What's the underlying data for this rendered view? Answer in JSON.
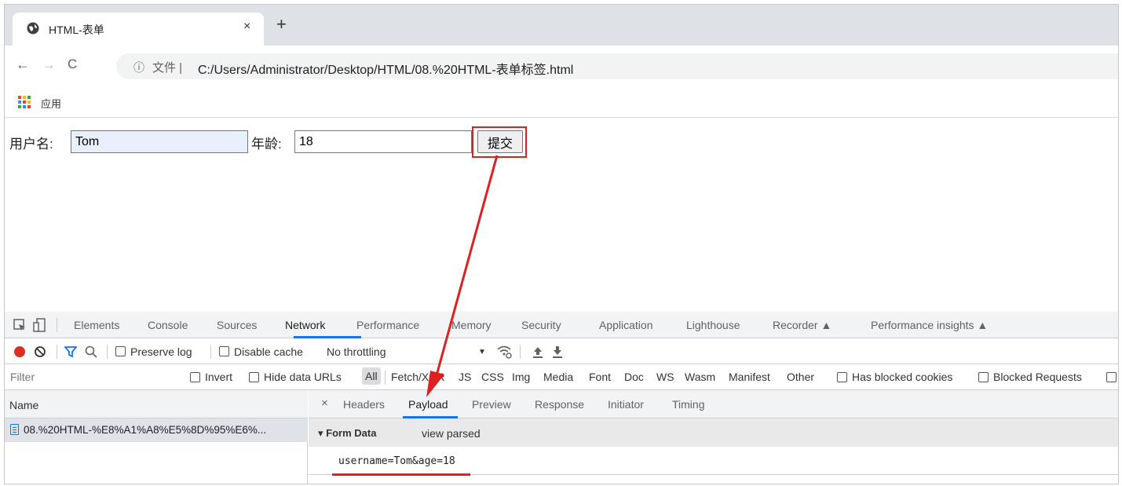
{
  "browser": {
    "tab_title": "HTML-表单",
    "tab_close": "×",
    "new_tab": "+",
    "back": "←",
    "forward": "→",
    "reload": "C",
    "info_icon": "ⓘ",
    "address_label": "文件 |",
    "url": "C:/Users/Administrator/Desktop/HTML/08.%20HTML-表单标签.html",
    "bookmark_apps": "应用"
  },
  "page": {
    "username_label": "用户名:",
    "username_value": "Tom",
    "age_label": "年龄:",
    "age_value": "18",
    "submit_label": "提交"
  },
  "devtools": {
    "tabs": [
      "Elements",
      "Console",
      "Sources",
      "Network",
      "Performance",
      "Memory",
      "Security",
      "Application",
      "Lighthouse",
      "Recorder ▲",
      "Performance insights ▲"
    ],
    "active_tab": "Network",
    "toolbar": {
      "preserve_log": "Preserve log",
      "disable_cache": "Disable cache",
      "throttling": "No throttling",
      "throttle_arrow": "▼"
    },
    "filter": {
      "placeholder": "Filter",
      "invert": "Invert",
      "hide_data_urls": "Hide data URLs",
      "types": [
        "All",
        "Fetch/XHR",
        "JS",
        "CSS",
        "Img",
        "Media",
        "Font",
        "Doc",
        "WS",
        "Wasm",
        "Manifest",
        "Other"
      ],
      "has_blocked_cookies": "Has blocked cookies",
      "blocked_requests": "Blocked Requests"
    },
    "requests": {
      "name_header": "Name",
      "rows": [
        "08.%20HTML-%E8%A1%A8%E5%8D%95%E6%..."
      ]
    },
    "detail": {
      "close": "×",
      "tabs": [
        "Headers",
        "Payload",
        "Preview",
        "Response",
        "Initiator",
        "Timing"
      ],
      "active_tab": "Payload",
      "form_data_title": "▾ Form Data",
      "view_parsed": "view parsed",
      "raw_payload": "username=Tom&age=18"
    }
  },
  "colors": {
    "accent": "#1a73e8",
    "annotation_red": "#e02020",
    "record_red": "#d93025",
    "autofill_bg": "#e8f0fe"
  }
}
